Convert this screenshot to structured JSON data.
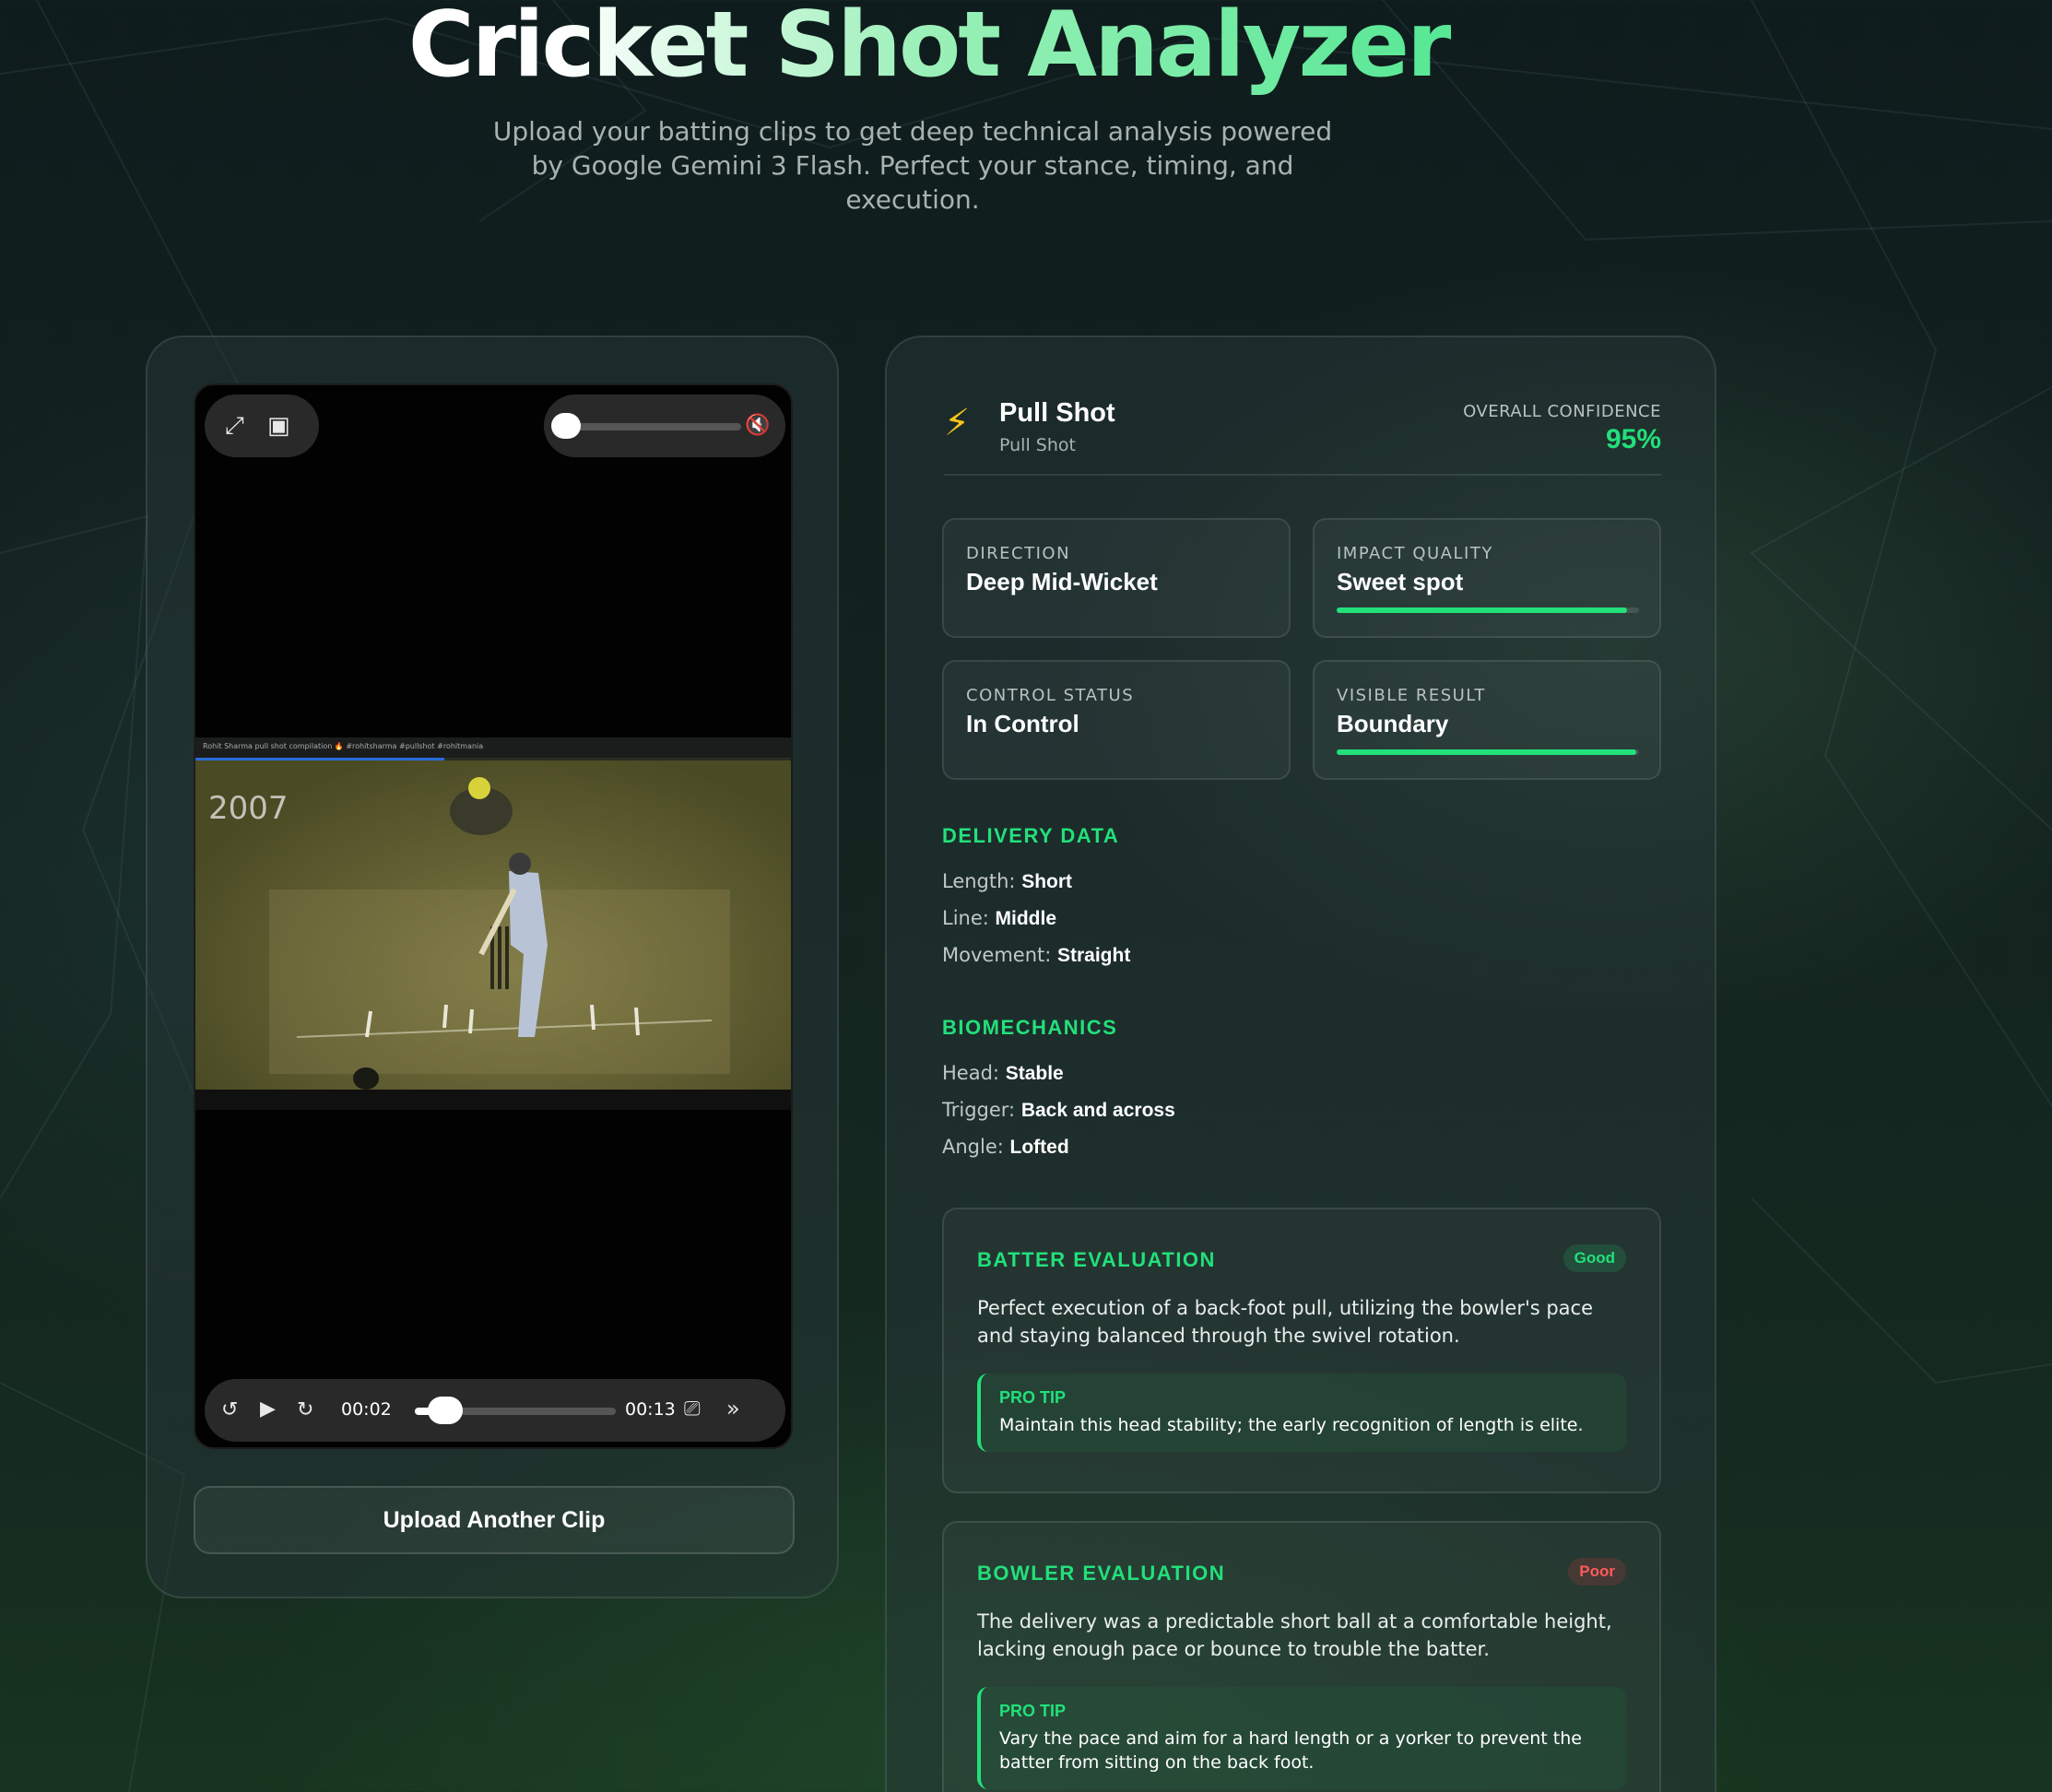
{
  "header": {
    "title": "Cricket Shot Analyzer",
    "subtitle": "Upload your batting clips to get deep technical analysis powered by Google Gemini 3 Flash. Perfect your stance, timing, and execution."
  },
  "player": {
    "top_text": "Rohit Sharma pull shot compilation 🔥 #rohitsharma #pullshot #rohitmania",
    "year_watermark": "2007",
    "current_time": "00:02",
    "duration": "00:13",
    "seek_fraction": 0.15,
    "volume_fraction": 0.0,
    "muted": true
  },
  "upload_button": "Upload Another Clip",
  "analysis": {
    "shot_name": "Pull Shot",
    "shot_subtitle": "Pull Shot",
    "confidence_label": "OVERALL CONFIDENCE",
    "confidence_value": "95%",
    "cards": [
      {
        "label": "DIRECTION",
        "value": "Deep Mid-Wicket"
      },
      {
        "label": "IMPACT QUALITY",
        "value": "Sweet spot",
        "bar_fraction": 0.96
      },
      {
        "label": "CONTROL STATUS",
        "value": "In Control"
      },
      {
        "label": "VISIBLE RESULT",
        "value": "Boundary",
        "bar_fraction": 0.99
      }
    ],
    "delivery": {
      "title": "DELIVERY DATA",
      "items": [
        {
          "key": "Length:",
          "value": "Short"
        },
        {
          "key": "Line:",
          "value": "Middle"
        },
        {
          "key": "Movement:",
          "value": "Straight"
        }
      ]
    },
    "biomechanics": {
      "title": "BIOMECHANICS",
      "items": [
        {
          "key": "Head:",
          "value": "Stable"
        },
        {
          "key": "Trigger:",
          "value": "Back and across"
        },
        {
          "key": "Angle:",
          "value": "Lofted"
        }
      ]
    },
    "batter_eval": {
      "title": "BATTER EVALUATION",
      "badge": "Good",
      "text": "Perfect execution of a back-foot pull, utilizing the bowler's pace and staying balanced through the swivel rotation.",
      "tip_label": "PRO TIP",
      "tip_text": "Maintain this head stability; the early recognition of length is elite."
    },
    "bowler_eval": {
      "title": "BOWLER EVALUATION",
      "badge": "Poor",
      "text": "The delivery was a predictable short ball at a comfortable height, lacking enough pace or bounce to trouble the batter.",
      "tip_label": "PRO TIP",
      "tip_text": "Vary the pace and aim for a hard length or a yorker to prevent the batter from sitting on the back foot."
    }
  },
  "colors": {
    "accent": "#22e07a",
    "poor": "#ff5a5a",
    "bolt": "#f5c518"
  },
  "icons": [
    "expand-icon",
    "picture-in-picture-icon",
    "mute-icon",
    "skip-back-15-icon",
    "play-icon",
    "skip-forward-15-icon",
    "airplay-icon",
    "playback-speed-icon",
    "bolt-icon"
  ]
}
